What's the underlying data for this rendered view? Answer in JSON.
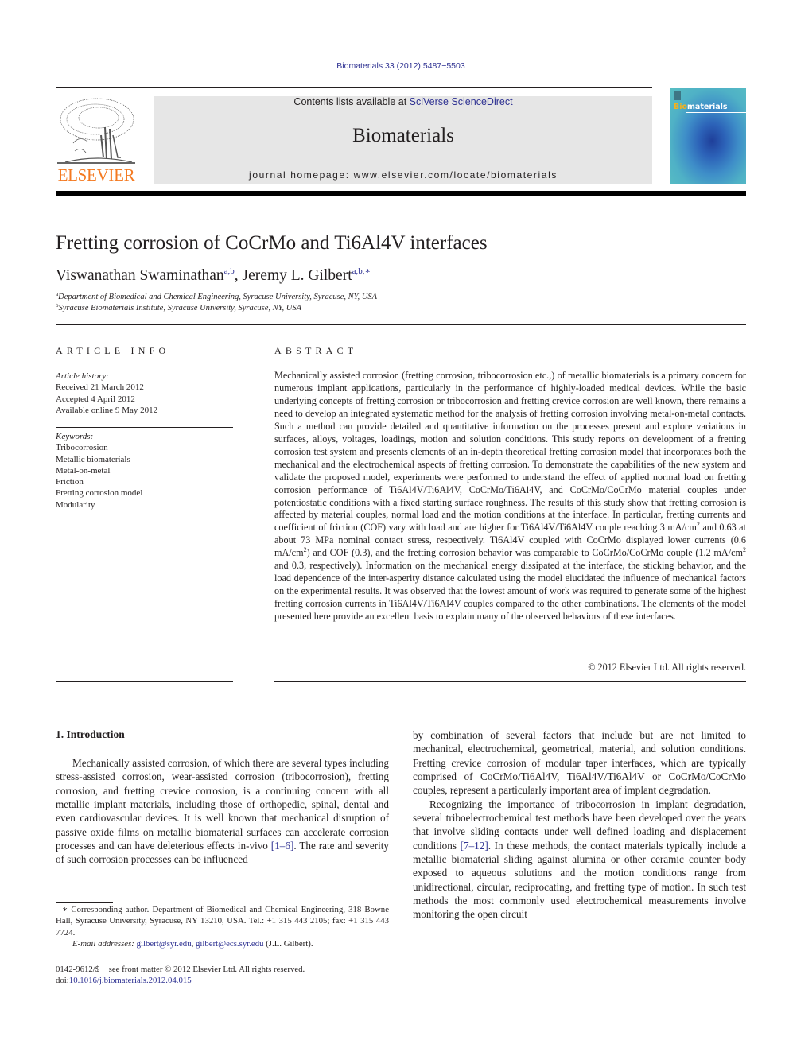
{
  "header": {
    "journal_ref": "Biomaterials 33 (2012) 5487−5503",
    "contents_prefix": "Contents lists available at ",
    "contents_link": "SciVerse ScienceDirect",
    "journal_title": "Biomaterials",
    "homepage": "journal homepage: www.elsevier.com/locate/biomaterials",
    "publisher_logo_text": "ELSEVIER",
    "cover": {
      "title_accent": "Bio",
      "title_rest": "materials"
    }
  },
  "colors": {
    "link": "#2e3192",
    "elsevier_orange": "#f47920",
    "banner_bg": "#e6e6e6",
    "text": "#231f20"
  },
  "article": {
    "title": "Fretting corrosion of CoCrMo and Ti6Al4V interfaces",
    "authors": [
      {
        "name": "Viswanathan Swaminathan",
        "marks": "a,b"
      },
      {
        "name": "Jeremy L. Gilbert",
        "marks": "a,b,∗"
      }
    ],
    "author_separator": ", ",
    "affiliations": [
      {
        "mark": "a",
        "text": "Department of Biomedical and Chemical Engineering, Syracuse University, Syracuse, NY, USA"
      },
      {
        "mark": "b",
        "text": "Syracuse Biomaterials Institute, Syracuse University, Syracuse, NY, USA"
      }
    ]
  },
  "article_info": {
    "heading": "ARTICLE INFO",
    "history_label": "Article history:",
    "history": [
      "Received 21 March 2012",
      "Accepted 4 April 2012",
      "Available online 9 May 2012"
    ],
    "keywords_label": "Keywords:",
    "keywords": [
      "Tribocorrosion",
      "Metallic biomaterials",
      "Metal-on-metal",
      "Friction",
      "Fretting corrosion model",
      "Modularity"
    ]
  },
  "abstract": {
    "heading": "ABSTRACT",
    "part1": "Mechanically assisted corrosion (fretting corrosion, tribocorrosion etc.,) of metallic biomaterials is a primary concern for numerous implant applications, particularly in the performance of highly-loaded medical devices. While the basic underlying concepts of fretting corrosion or tribocorrosion and fretting crevice corrosion are well known, there remains a need to develop an integrated systematic method for the analysis of fretting corrosion involving metal-on-metal contacts. Such a method can provide detailed and quantitative information on the processes present and explore variations in surfaces, alloys, voltages, loadings, motion and solution conditions. This study reports on development of a fretting corrosion test system and presents elements of an in-depth theoretical fretting corrosion model that incorporates both the mechanical and the electrochemical aspects of fretting corrosion. To demonstrate the capabilities of the new system and validate the proposed model, experiments were performed to understand the effect of applied normal load on fretting corrosion performance of Ti6Al4V/Ti6Al4V, CoCrMo/Ti6Al4V, and CoCrMo/CoCrMo material couples under potentiostatic conditions with a fixed starting surface rough­ness. The results of this study show that fretting corrosion is affected by material couples, normal load and the motion conditions at the interface. In particular, fretting currents and coefficient of friction (COF) vary with load and are higher for Ti6Al4V/Ti6Al4V couple reaching 3 mA/cm",
    "part2": " and 0.63 at about 73 MPa nominal contact stress, respectively. Ti6Al4V coupled with CoCrMo displayed lower currents (0.6 mA/cm",
    "part3": ") and COF (0.3), and the fretting corrosion behavior was comparable to CoCrMo/CoCrMo couple (1.2 mA/cm",
    "part4": " and 0.3, respectively). Information on the mechanical energy dissipated at the interface, the sticking behavior, and the load dependence of the inter-asperity distance calculated using the model elucidated the influence of mechanical factors on the experimental results. It was observed that the lowest amount of work was required to generate some of the highest fretting corrosion currents in Ti6Al4V/Ti6Al4V couples compared to the other combinations. The elements of the model presented here provide an excellent basis to explain many of the observed behaviors of these interfaces.",
    "superscript": "2",
    "copyright": "© 2012 Elsevier Ltd. All rights reserved."
  },
  "introduction": {
    "heading": "1.  Introduction",
    "left_p1_text": "Mechanically assisted corrosion, of which there are several types including stress-assisted corrosion, wear-assisted corrosion (tribocorrosion), fretting corrosion, and fretting crevice corrosion, is a continuing concern with all metallic implant materials, including those of orthopedic, spinal, dental and even cardiovas­cular devices. It is well known that mechanical disruption of passive oxide films on metallic biomaterial surfaces can accelerate corrosion processes and can have deleterious effects in-vivo ",
    "left_p1_cite": "[1–6]",
    "left_p1_tail": ". The rate and severity of such corrosion processes can be influenced",
    "right_p1": "by combination of several factors that include but are not limited to mechanical, electrochemical, geometrical, material, and solution conditions. Fretting crevice corrosion of modular taper interfaces, which are typically comprised of CoCrMo/Ti6Al4V, Ti6Al4V/Ti6Al4V or CoCrMo/CoCrMo couples, represent a particu­larly important area of implant degradation.",
    "right_p2_text": "Recognizing the importance of tribocorrosion in implant degradation, several triboelectrochemical test methods have been developed over the years that involve sliding contacts under well defined loading and displacement conditions ",
    "right_p2_cite": "[7–12]",
    "right_p2_tail": ". In these methods, the contact materials typically include a metallic biomaterial sliding against alumina or other ceramic counter body exposed to aqueous solutions and the motion conditions range from unidirectional, circular, reciprocating, and fretting type of motion. In such test methods the most commonly used electro­chemical measurements involve monitoring the open circuit"
  },
  "footnote": {
    "corresponding": "∗ Corresponding author. Department of Biomedical and Chemical Engi­neering, 318 Bowne Hall, Syracuse University, Syracuse, NY 13210, USA. Tel.: +1 315 443 2105; fax: +1 315 443 7724.",
    "email_label": "E-mail addresses:",
    "emails": [
      "gilbert@syr.edu",
      "gilbert@ecs.syr.edu"
    ],
    "email_owner": " (J.L. Gilbert).",
    "issn_line": "0142-9612/$ − see front matter © 2012 Elsevier Ltd. All rights reserved.",
    "doi_label": "doi:",
    "doi": "10.1016/j.biomaterials.2012.04.015"
  }
}
